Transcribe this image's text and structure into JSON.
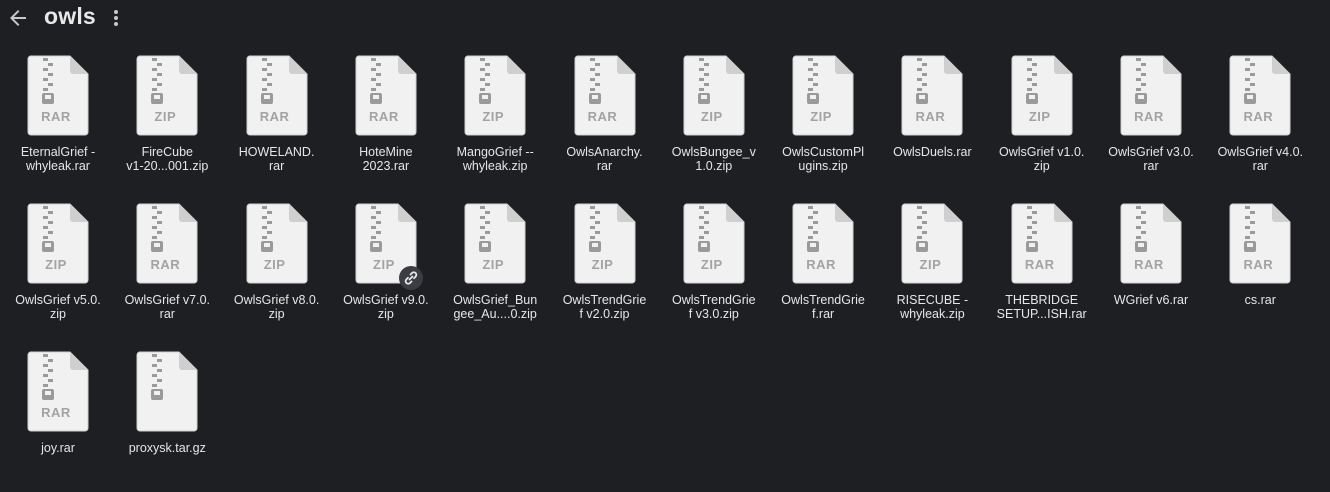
{
  "header": {
    "title": "owls"
  },
  "icons": {
    "back": "arrow-left-icon",
    "more": "more-vertical-icon",
    "file": "zip-file-icon",
    "shared": "link-icon"
  },
  "colors": {
    "background": "#1e1f22",
    "file_icon": "#f1f1f1",
    "zipper": "#9a9a9a",
    "type_label": "#a3a3a3"
  },
  "files": [
    {
      "name": "EternalGrief -\nwhyleak.rar",
      "type": "RAR"
    },
    {
      "name": "FireCube\nv1-20...001.zip",
      "type": "ZIP"
    },
    {
      "name": "HOWELAND.\nrar",
      "type": "RAR"
    },
    {
      "name": "HoteMine\n2023.rar",
      "type": "RAR"
    },
    {
      "name": "MangoGrief --\nwhyleak.zip",
      "type": "ZIP"
    },
    {
      "name": "OwlsAnarchy.\nrar",
      "type": "RAR"
    },
    {
      "name": "OwlsBungee_v\n1.0.zip",
      "type": "ZIP"
    },
    {
      "name": "OwlsCustomPl\nugins.zip",
      "type": "ZIP"
    },
    {
      "name": "OwlsDuels.rar",
      "type": "RAR"
    },
    {
      "name": "OwlsGrief v1.0.\nzip",
      "type": "ZIP"
    },
    {
      "name": "OwlsGrief v3.0.\nrar",
      "type": "RAR"
    },
    {
      "name": "OwlsGrief v4.0.\nrar",
      "type": "RAR"
    },
    {
      "name": "OwlsGrief v5.0.\nzip",
      "type": "ZIP"
    },
    {
      "name": "OwlsGrief v7.0.\nrar",
      "type": "RAR"
    },
    {
      "name": "OwlsGrief v8.0.\nzip",
      "type": "ZIP"
    },
    {
      "name": "OwlsGrief v9.0.\nzip",
      "type": "ZIP",
      "shared": true
    },
    {
      "name": "OwlsGrief_Bun\ngee_Au....0.zip",
      "type": "ZIP"
    },
    {
      "name": "OwlsTrendGrie\nf v2.0.zip",
      "type": "ZIP"
    },
    {
      "name": "OwlsTrendGrie\nf v3.0.zip",
      "type": "ZIP"
    },
    {
      "name": "OwlsTrendGrie\nf.rar",
      "type": "RAR"
    },
    {
      "name": "RISECUBE -\nwhyleak.zip",
      "type": "ZIP"
    },
    {
      "name": "THEBRIDGE\nSETUP...ISH.rar",
      "type": "RAR"
    },
    {
      "name": "WGrief v6.rar",
      "type": "RAR"
    },
    {
      "name": "cs.rar",
      "type": "RAR"
    },
    {
      "name": "joy.rar",
      "type": "RAR"
    },
    {
      "name": "proxysk.tar.gz",
      "type": ""
    }
  ]
}
